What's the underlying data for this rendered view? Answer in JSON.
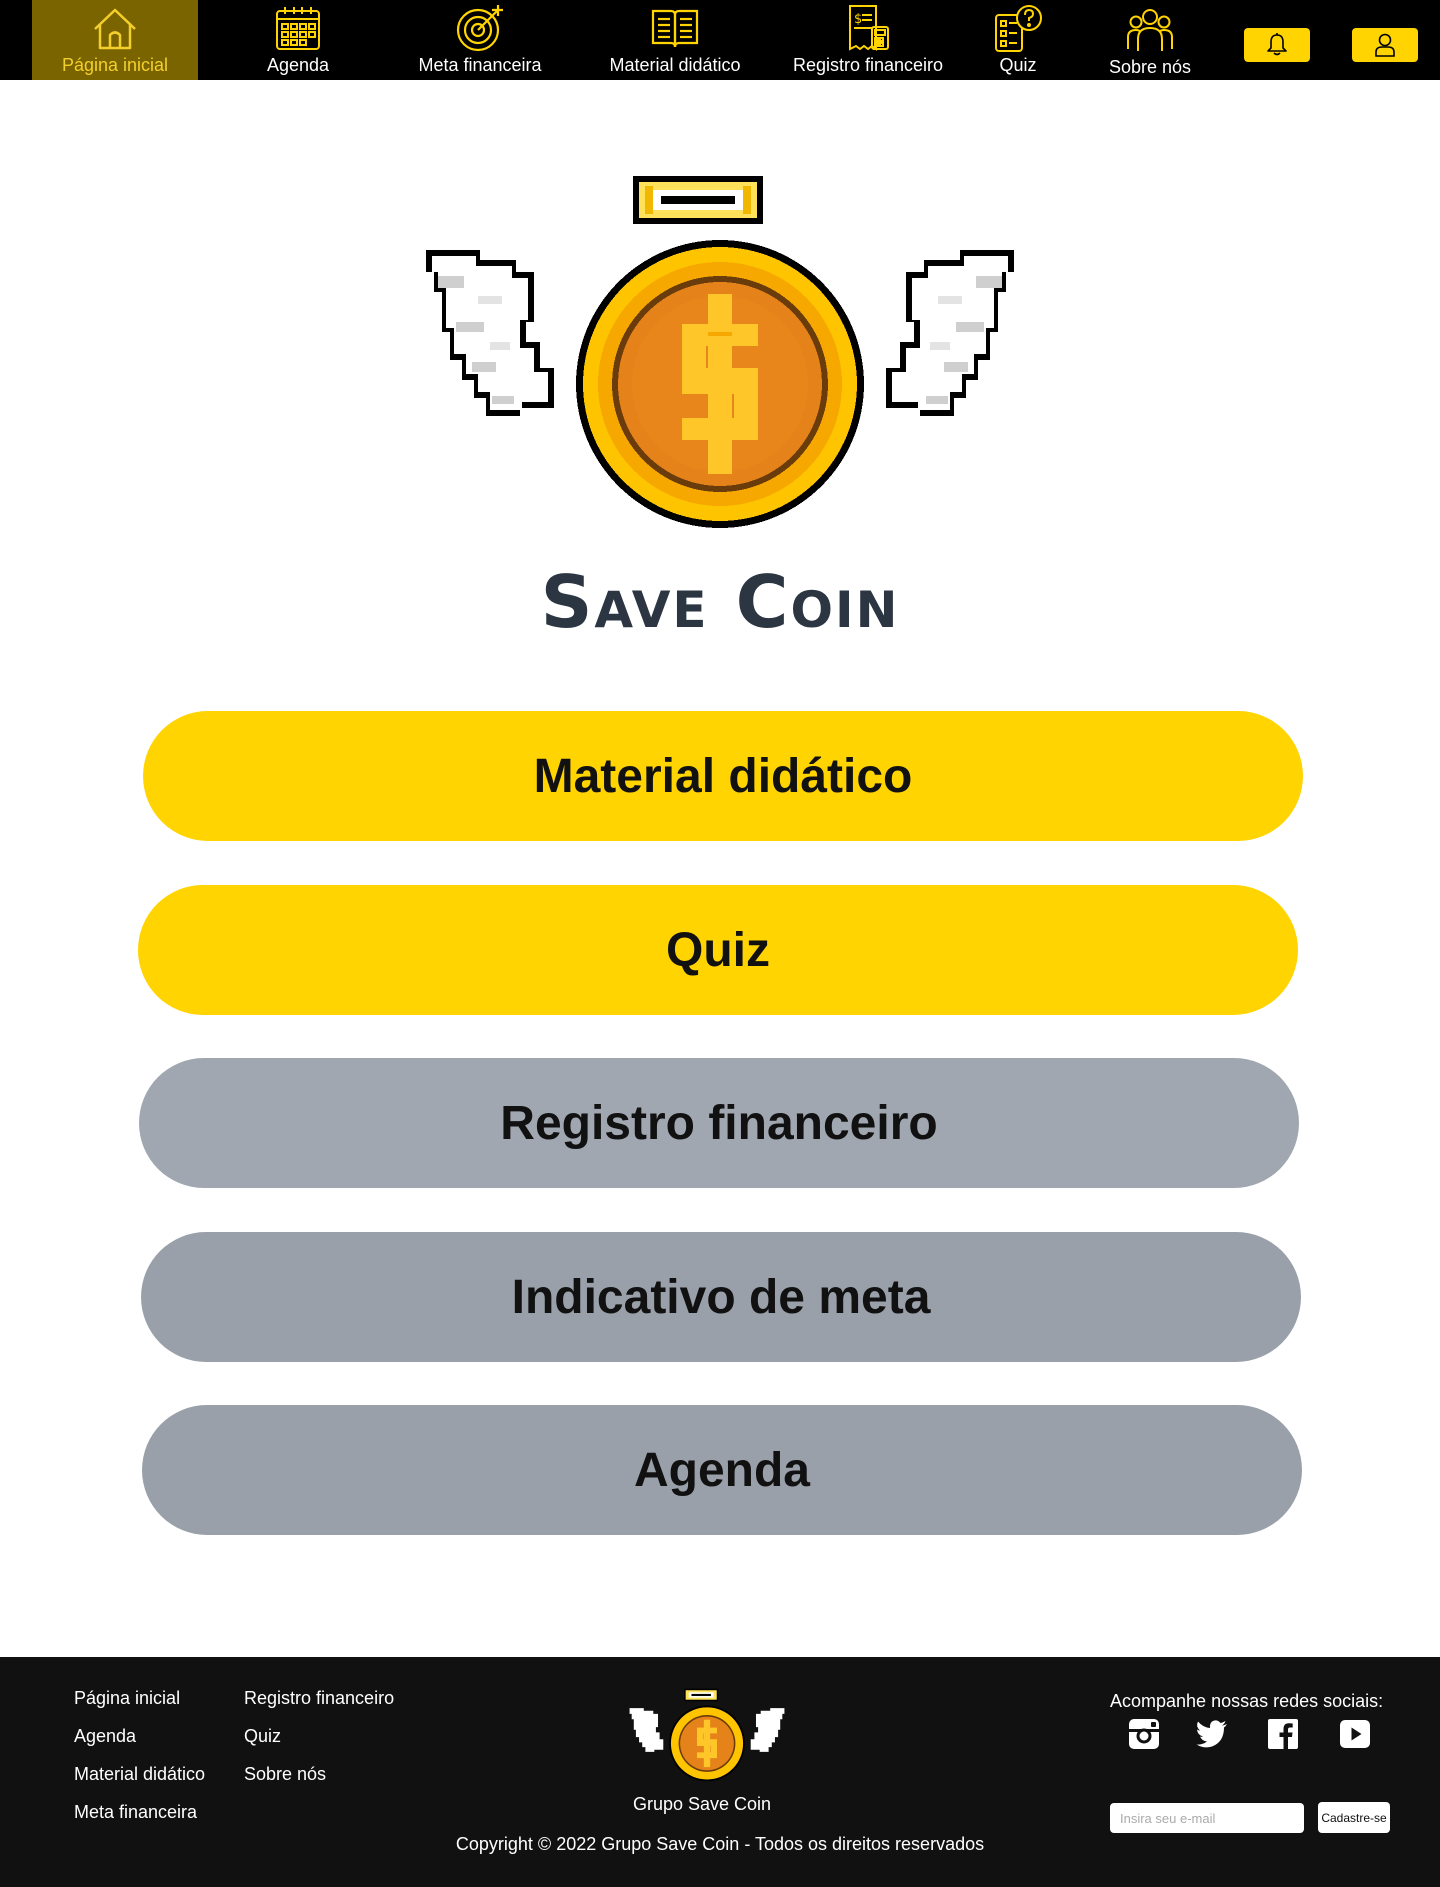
{
  "nav": {
    "items": [
      {
        "label": "Página inicial",
        "icon": "house-icon"
      },
      {
        "label": "Agenda",
        "icon": "calendar-icon"
      },
      {
        "label": "Meta financeira",
        "icon": "target-icon"
      },
      {
        "label": "Material didático",
        "icon": "open-book-icon"
      },
      {
        "label": "Registro financeiro",
        "icon": "receipt-calculator-icon"
      },
      {
        "label": "Quiz",
        "icon": "quiz-icon"
      },
      {
        "label": "Sobre nós",
        "icon": "group-icon"
      }
    ],
    "active_index": 0,
    "buttons": [
      {
        "icon": "bell-icon"
      },
      {
        "icon": "user-icon"
      }
    ]
  },
  "brand": {
    "title": "Save Coin",
    "logo_icon": "winged-coin-logo"
  },
  "main_buttons": [
    {
      "label": "Material didático",
      "color": "#ffd400"
    },
    {
      "label": "Quiz",
      "color": "#ffd400"
    },
    {
      "label": "Registro financeiro",
      "color": "#a0a7b0"
    },
    {
      "label": "Indicativo de meta",
      "color": "#9aa0aa"
    },
    {
      "label": "Agenda",
      "color": "#9aa0aa"
    }
  ],
  "footer": {
    "links_col1": [
      "Página inicial",
      "Agenda",
      "Material didático",
      "Meta financeira"
    ],
    "links_col2": [
      "Registro financeiro",
      "Quiz",
      "Sobre nós"
    ],
    "brand": "Grupo Save Coin",
    "copyright": "Copyright © 2022 Grupo Save Coin - Todos os direitos reservados",
    "social_title": "Acompanhe nossas redes sociais:",
    "social_icons": [
      "instagram-icon",
      "twitter-icon",
      "facebook-icon",
      "youtube-icon"
    ],
    "email_placeholder": "Insira seu e-mail",
    "subscribe_label": "Cadastre-se"
  },
  "colors": {
    "nav_bg": "#000000",
    "nav_active_bg": "#7a6400",
    "accent_yellow": "#ffd400",
    "footer_bg": "#111111",
    "title_color": "#2c3642"
  }
}
